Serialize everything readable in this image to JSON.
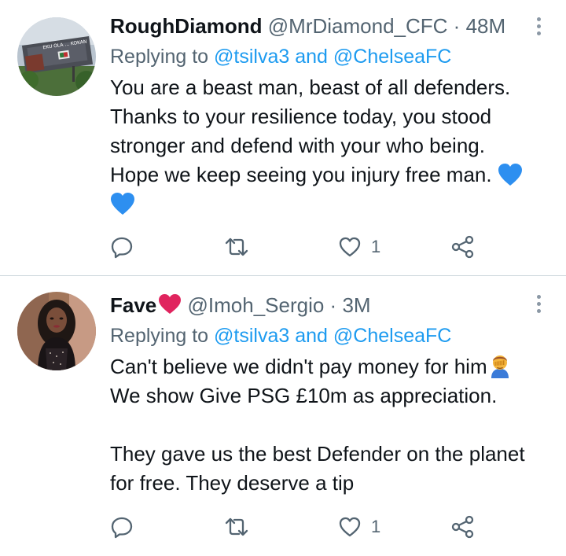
{
  "tweets": [
    {
      "name": "RoughDiamond",
      "handle": "@MrDiamond_CFC",
      "sep": "·",
      "time": "48M",
      "replying_prefix": "Replying to",
      "mention1": "@tsilva3",
      "and": "and",
      "mention2": "@ChelseaFC",
      "lines": [
        "You are a beast man, beast of all defenders.",
        "Thanks to your resilience today, you stood",
        "stronger and defend with your who being.",
        "Hope we keep seeing you injury free man."
      ],
      "emoji": [
        "blue-heart",
        "blue-heart"
      ],
      "likes": "1",
      "icons": [
        "reply-icon",
        "retweet-icon",
        "like-icon",
        "share-icon",
        "more-icon"
      ],
      "avatar_billboard_text": "EKU OLA ... KOKAN"
    },
    {
      "name": "Fave",
      "handle": "@Imoh_Sergio",
      "sep": "·",
      "time": "3M",
      "replying_prefix": "Replying to",
      "mention1": "@tsilva3",
      "and": "and",
      "mention2": "@ChelseaFC",
      "lines": [
        "Can't believe we didn't pay money for him",
        "We show Give PSG £10m as appreciation.",
        "",
        "They gave us the best Defender on the planet",
        "for free. They deserve a tip"
      ],
      "emoji": [
        "red-heart",
        "facepalm"
      ],
      "likes": "1",
      "icons": [
        "reply-icon",
        "retweet-icon",
        "like-icon",
        "share-icon",
        "more-icon"
      ]
    }
  ],
  "colors": {
    "link": "#1d9bf0",
    "secondary": "#536471",
    "text": "#0f1419",
    "divider": "#cfd9de",
    "blue_heart": "#2d8ff0",
    "red_heart": "#e0245e"
  }
}
